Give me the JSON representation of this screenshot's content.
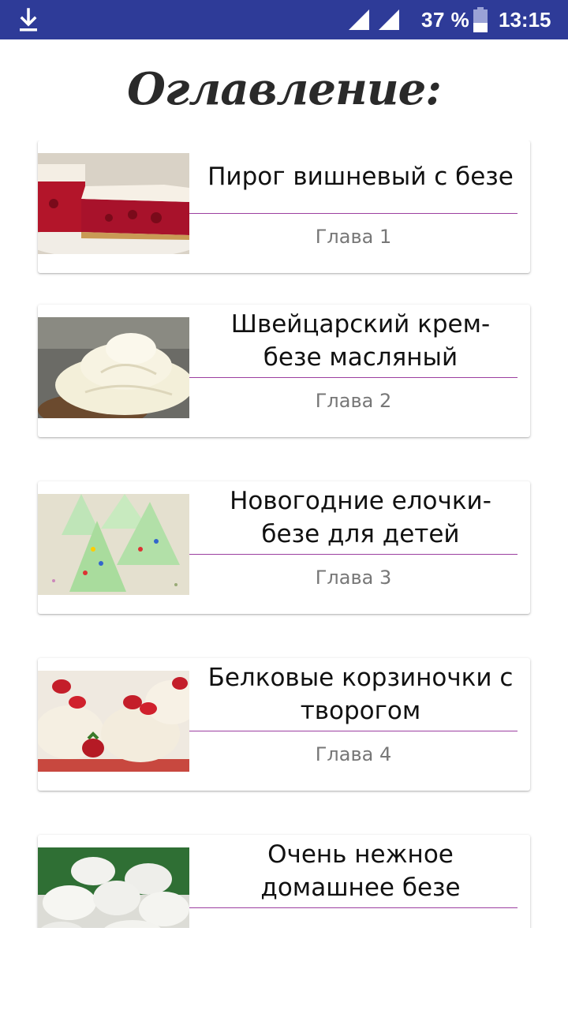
{
  "status_bar": {
    "battery_percent": "37 %",
    "time": "13:15",
    "icons": [
      "download-icon",
      "signal-icon",
      "signal-icon",
      "battery-icon"
    ],
    "background_color": "#2e3b98"
  },
  "header": {
    "title": "Оглавление:"
  },
  "chapters": [
    {
      "title": "Пирог вишневый с безе",
      "chapter": "Глава 1",
      "thumbnail": "cherry-pie-image"
    },
    {
      "title": "Швейцарский крем-безе масляный",
      "chapter": "Глава 2",
      "thumbnail": "cream-cupcake-image"
    },
    {
      "title": "Новогодние елочки-безе для детей",
      "chapter": "Глава 3",
      "thumbnail": "green-meringue-trees-image"
    },
    {
      "title": "Белковые корзиночки с творогом",
      "chapter": "Глава 4",
      "thumbnail": "strawberry-baskets-image"
    },
    {
      "title": "Очень нежное домашнее безе",
      "chapter": "",
      "thumbnail": "white-meringues-image"
    }
  ],
  "colors": {
    "divider": "#9c3fa0",
    "chapter_text": "#777777"
  }
}
